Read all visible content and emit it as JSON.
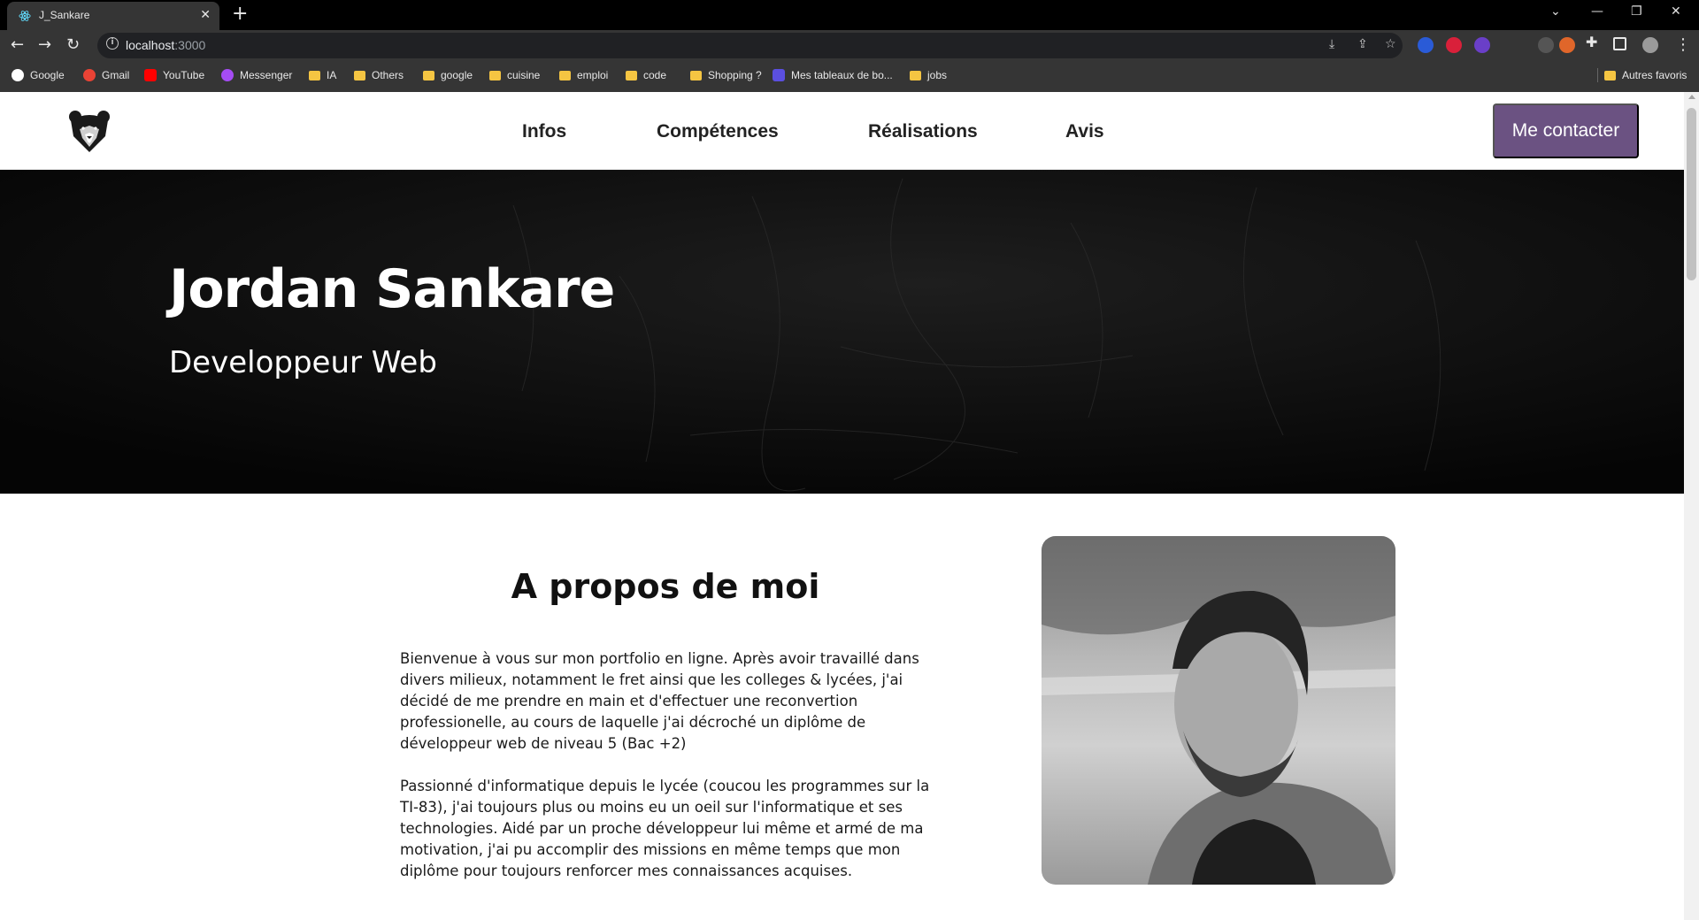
{
  "browser": {
    "tab_title": "J_Sankare",
    "url_host": "localhost",
    "url_port": ":3000",
    "bookmarks": [
      {
        "label": "Google",
        "icon": "google-icon"
      },
      {
        "label": "Gmail",
        "icon": "gmail-icon"
      },
      {
        "label": "YouTube",
        "icon": "youtube-icon"
      },
      {
        "label": "Messenger",
        "icon": "messenger-icon"
      },
      {
        "label": "IA",
        "icon": "folder-icon"
      },
      {
        "label": "Others",
        "icon": "folder-icon"
      },
      {
        "label": "google",
        "icon": "folder-icon"
      },
      {
        "label": "cuisine",
        "icon": "folder-icon"
      },
      {
        "label": "emploi",
        "icon": "folder-icon"
      },
      {
        "label": "code",
        "icon": "folder-icon"
      },
      {
        "label": "Shopping ?",
        "icon": "folder-icon"
      },
      {
        "label": "Mes tableaux de bo...",
        "icon": "trello-icon"
      },
      {
        "label": "jobs",
        "icon": "folder-icon"
      }
    ],
    "other_bookmarks": "Autres favoris"
  },
  "site": {
    "nav": [
      "Infos",
      "Compétences",
      "Réalisations",
      "Avis"
    ],
    "contact_button": "Me contacter",
    "hero": {
      "name": "Jordan Sankare",
      "role": "Developpeur Web"
    },
    "about": {
      "title": "A propos de moi",
      "paragraphs": [
        "Bienvenue à vous sur mon portfolio en ligne. Après avoir travaillé dans divers milieux, notamment le fret ainsi que les colleges & lycées, j'ai décidé de me prendre en main et d'effectuer une reconvertion professionelle, au cours de laquelle j'ai décroché un diplôme de développeur web de niveau 5 (Bac +2)",
        "Passionné d'informatique depuis le lycée (coucou les programmes sur la TI-83), j'ai toujours plus ou moins eu un oeil sur l'informatique et ses technologies. Aidé par un proche développeur lui même et armé de ma motivation, j'ai pu accomplir des missions en même temps que mon diplôme pour toujours renforcer mes connaissances acquises."
      ]
    }
  },
  "colors": {
    "accent": "#6b5282",
    "hero_bg": "#070707"
  }
}
